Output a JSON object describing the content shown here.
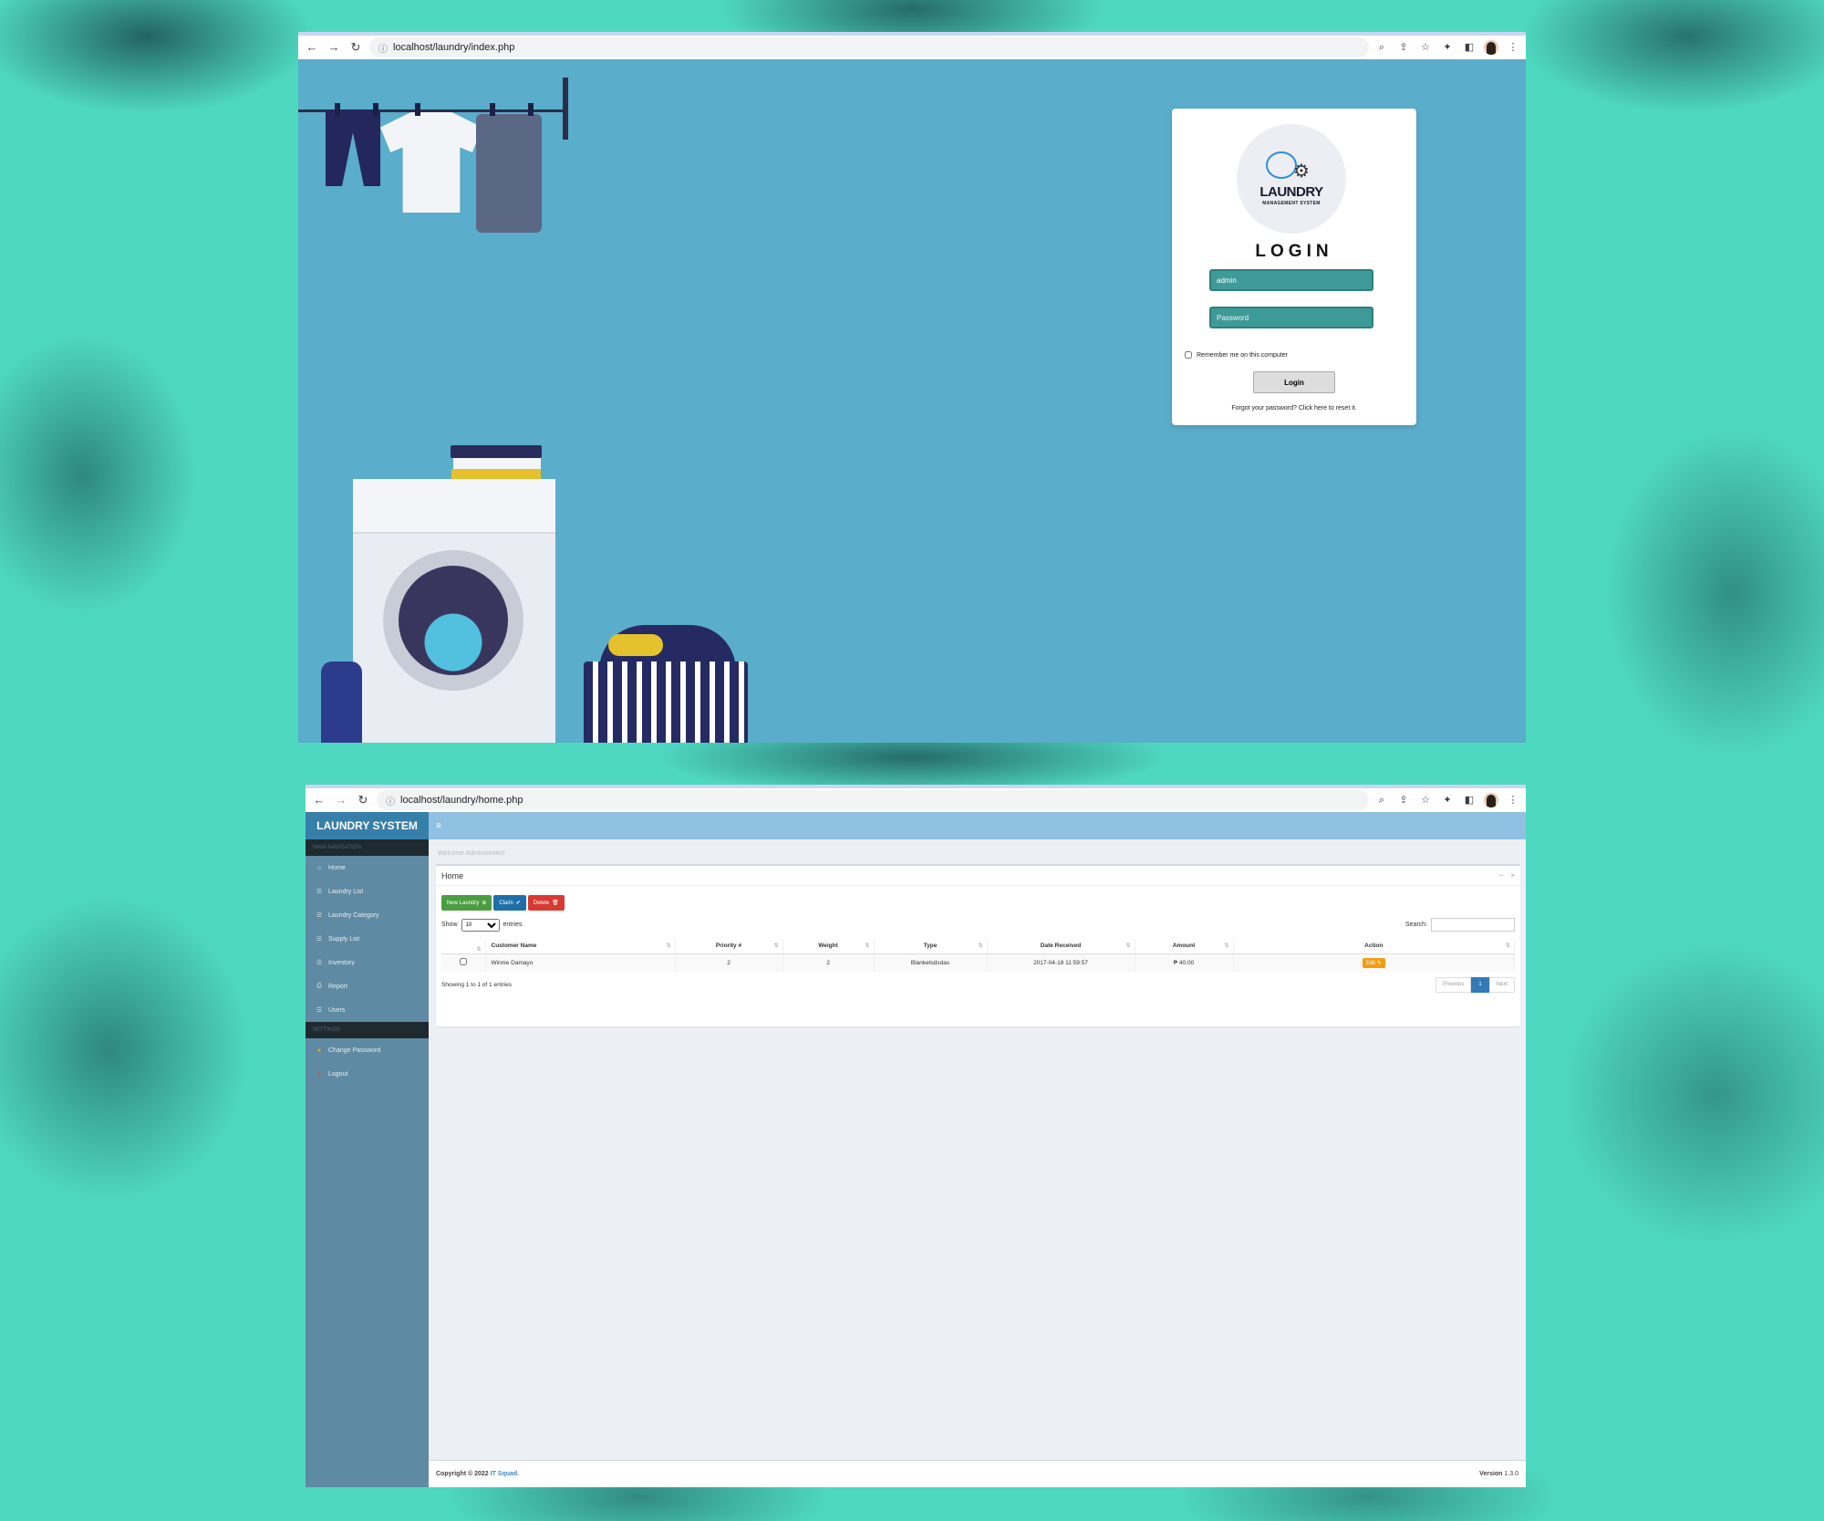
{
  "login_window": {
    "url": "localhost/laundry/index.php",
    "logo_title": "LAUNDRY",
    "logo_subtitle": "MANAGEMENT SYSTEM",
    "title": "LOGIN",
    "username_value": "admin",
    "password_placeholder": "Password",
    "remember_label": "Remember me on this computer",
    "login_button": "Login",
    "forgot_text": "Forgot your password? Click here to reset it."
  },
  "home_window": {
    "url": "localhost/laundry/home.php",
    "brand": "LAUNDRY SYSTEM",
    "sidebar": {
      "main_nav_header": "MAIN NAVIGATION",
      "items": [
        {
          "label": "Home",
          "icon": "home-icon"
        },
        {
          "label": "Laundry List",
          "icon": "list-icon"
        },
        {
          "label": "Laundry Category",
          "icon": "list-icon"
        },
        {
          "label": "Supply List",
          "icon": "list-icon"
        },
        {
          "label": "Inventory",
          "icon": "list-icon"
        },
        {
          "label": "Report",
          "icon": "print-icon"
        },
        {
          "label": "Users",
          "icon": "list-icon"
        }
      ],
      "settings_header": "SETTINGS",
      "settings_items": [
        {
          "label": "Change Password",
          "icon": "circle-icon",
          "color": "#f39c12"
        },
        {
          "label": "Logout",
          "icon": "circle-icon",
          "color": "#dd4b39"
        }
      ]
    },
    "welcome": "Welcome Administrator!",
    "box_title": "Home",
    "buttons": {
      "new_laundry": "New Laundry",
      "claim": "Claim",
      "delete": "Delete"
    },
    "length": {
      "show": "Show",
      "value": "10",
      "entries": "entries"
    },
    "search_label": "Search:",
    "table": {
      "columns": [
        "",
        "Customer Name",
        "Priority #",
        "Weight",
        "Type",
        "Date Received",
        "Amount",
        "Action"
      ],
      "rows": [
        {
          "customer": "Winnie Damayo",
          "priority": "2",
          "weight": "2",
          "type": "Blanketsdsdas",
          "date": "2017-04-18 11:59:57",
          "amount": "₱ 40.00",
          "action": "Edit"
        }
      ]
    },
    "info": "Showing 1 to 1 of 1 entries",
    "pager": {
      "previous": "Previous",
      "current": "1",
      "next": "Next"
    },
    "footer": {
      "copyright": "Copyright © 2022",
      "company": "IT Squad.",
      "version_label": "Version",
      "version": "1.3.0"
    }
  },
  "colors": {
    "page_background": "#4fd8c0",
    "login_stage": "#5aadcb",
    "login_input": "#3e9a97",
    "sidebar": "#5f8aa3",
    "brand_bar": "#367fa9",
    "topbar": "#90c0e2",
    "btn_green": "#4a9e41",
    "btn_blue": "#1e6fa8",
    "btn_red": "#d73a31",
    "btn_edit": "#f39c12"
  }
}
